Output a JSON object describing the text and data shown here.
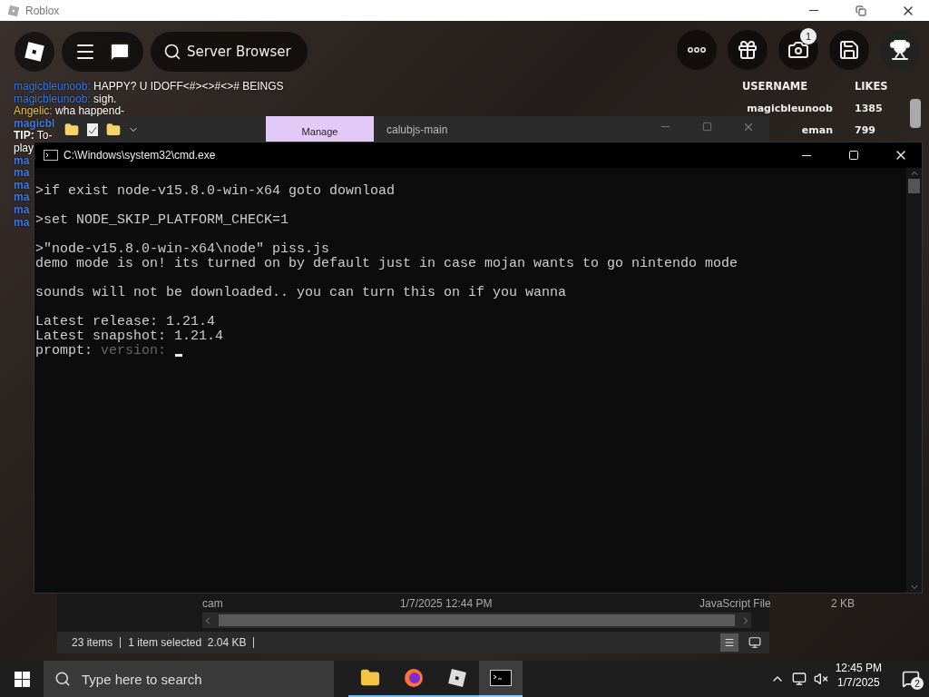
{
  "app_window": {
    "title": "Roblox"
  },
  "game_toolbar": {
    "server_button": "Server Browser",
    "camera_badge": "1"
  },
  "chat": [
    {
      "name": "magicbleunoob:",
      "text": "HAPPY? U IDOFF<#><>#<># BEINGS",
      "color": "#3d7be0"
    },
    {
      "name": "magicbleunoob:",
      "text": "sigh.",
      "color": "#3d7be0"
    },
    {
      "name": "Angelic:",
      "text": "wha happend-",
      "color": "#e8c53c"
    },
    {
      "name": "magicbl",
      "color": "#3d7be0"
    },
    {
      "name": "TIP:",
      "text": "To-",
      "color": "#ffffff"
    },
    {
      "text": "play"
    },
    {
      "name": "ma",
      "color": "#3d7be0"
    },
    {
      "name": "ma",
      "color": "#3d7be0"
    },
    {
      "name": "ma",
      "color": "#3d7be0"
    },
    {
      "name": "ma",
      "color": "#3d7be0"
    },
    {
      "name": "ma",
      "color": "#3d7be0"
    },
    {
      "name": "ma",
      "color": "#3d7be0"
    }
  ],
  "leaderboard": {
    "columns": [
      "USERNAME",
      "LIKES"
    ],
    "rows": [
      {
        "username": "magicbleunoob",
        "likes": "1385"
      },
      {
        "username": "eman",
        "likes": "799"
      }
    ]
  },
  "explorer": {
    "ribbon_tab": "Manage",
    "title": "calubjs-main",
    "file_row": {
      "name": "cam",
      "modified": "1/7/2025 12:44 PM",
      "type": "JavaScript File",
      "size": "2 KB"
    },
    "status": [
      "23 items",
      "1 item selected  2.04 KB"
    ]
  },
  "terminal": {
    "title": "C:\\Windows\\system32\\cmd.exe",
    "blocks": [
      [
        ">if exist node-v15.8.0-win-x64 goto download"
      ],
      [
        ">set NODE_SKIP_PLATFORM_CHECK=1"
      ],
      [
        ">\"node-v15.8.0-win-x64\\node\" piss.js",
        "demo mode is on! its turned on by default just in case mojan wants to go nintendo mode"
      ],
      [
        "sounds will not be downloaded.. you can turn this on if you wanna"
      ],
      [
        "Latest release: 1.21.4",
        "Latest snapshot: 1.21.4"
      ]
    ],
    "prompt": {
      "label": "prompt:",
      "placeholder": "version:"
    }
  },
  "taskbar": {
    "search_placeholder": "Type here to search",
    "apps": [
      {
        "kind": "folder",
        "selected": false
      },
      {
        "kind": "browser",
        "selected": false
      },
      {
        "kind": "roblox",
        "selected": false
      },
      {
        "kind": "terminal",
        "selected": true
      }
    ],
    "time": "12:45 PM",
    "date": "1/7/2025",
    "notification_count": "2"
  }
}
